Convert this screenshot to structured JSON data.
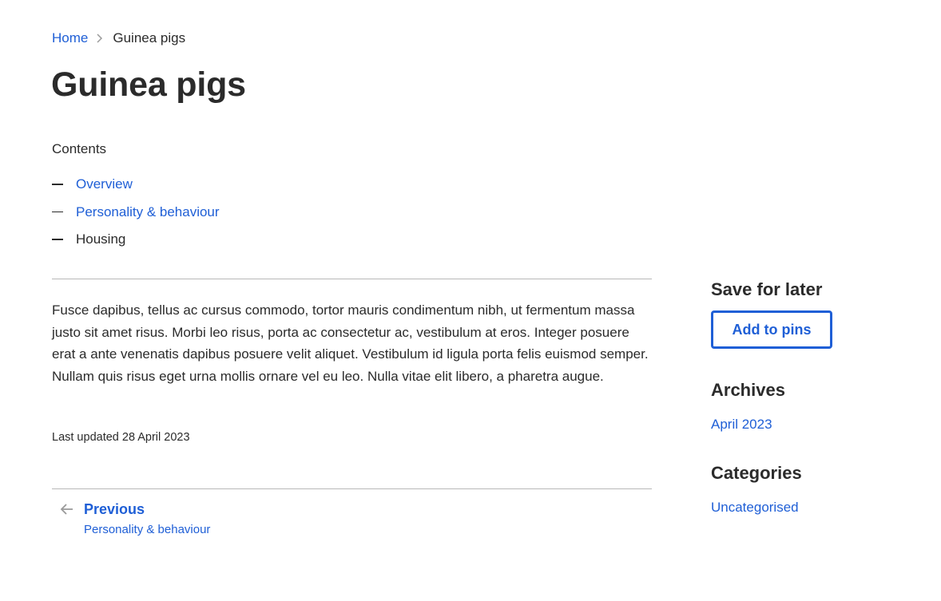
{
  "breadcrumb": {
    "home": "Home",
    "current": "Guinea pigs"
  },
  "page": {
    "title": "Guinea pigs"
  },
  "contents": {
    "heading": "Contents",
    "items": [
      {
        "label": "Overview",
        "link": true
      },
      {
        "label": "Personality & behaviour",
        "link": true
      },
      {
        "label": "Housing",
        "link": false
      }
    ]
  },
  "article": {
    "body": "Fusce dapibus, tellus ac cursus commodo, tortor mauris condimentum nibh, ut fermentum massa justo sit amet risus. Morbi leo risus, porta ac consectetur ac, vestibulum at eros. Integer posuere erat a ante venenatis dapibus posuere velit aliquet. Vestibulum id ligula porta felis euismod semper. Nullam quis risus eget urna mollis ornare vel eu leo. Nulla vitae elit libero, a pharetra augue.",
    "last_updated": "Last updated 28 April 2023"
  },
  "pagination": {
    "previous_label": "Previous",
    "previous_title": "Personality & behaviour",
    "icon": "arrow-left-icon"
  },
  "sidebar": {
    "save_heading": "Save for later",
    "pins_button": "Add to pins",
    "archives_heading": "Archives",
    "archive_link": "April 2023",
    "categories_heading": "Categories",
    "category_link": "Uncategorised"
  },
  "colors": {
    "link": "#1f5fd6",
    "text": "#2b2b2b",
    "divider": "#b8b8b8",
    "icon_grey": "#9a9a9a"
  }
}
